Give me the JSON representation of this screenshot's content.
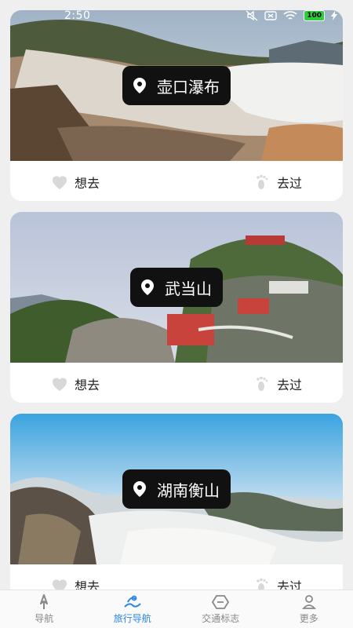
{
  "status": {
    "time": "2:50",
    "battery": "100"
  },
  "spots": [
    {
      "name": "壶口瀑布",
      "want_label": "想去",
      "been_label": "去过"
    },
    {
      "name": "武当山",
      "want_label": "想去",
      "been_label": "去过"
    },
    {
      "name": "湖南衡山",
      "want_label": "想去",
      "been_label": "去过"
    }
  ],
  "tabs": [
    {
      "label": "导航",
      "icon": "compass-icon",
      "active": false
    },
    {
      "label": "旅行导航",
      "icon": "travel-map-icon",
      "active": true
    },
    {
      "label": "交通标志",
      "icon": "sign-icon",
      "active": false
    },
    {
      "label": "更多",
      "icon": "person-icon",
      "active": false
    }
  ],
  "colors": {
    "accent": "#2a86e6",
    "badge_bg": "#111111",
    "heart": "#d8d8d8"
  }
}
